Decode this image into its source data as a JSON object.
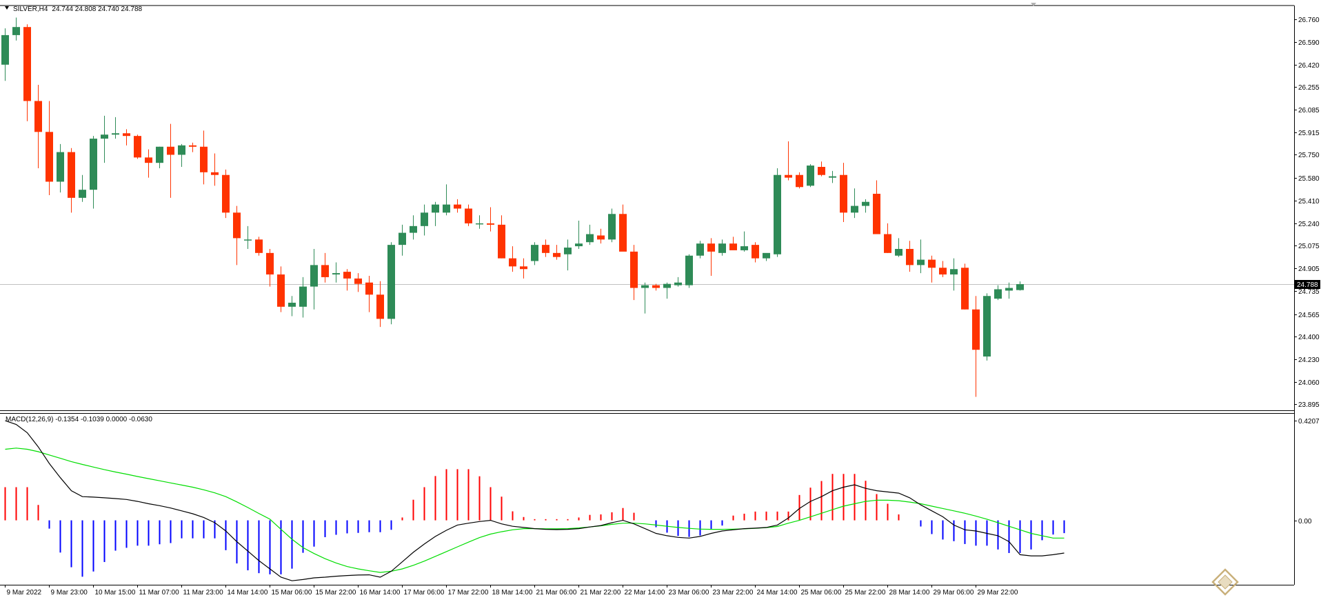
{
  "header": {
    "symbol": "SILVER,H4",
    "ohlc": "24.744 24.808 24.740 24.788"
  },
  "colors": {
    "bull": "#2e8b57",
    "bear": "#ff3300",
    "macd_pos": "#ff0000",
    "macd_neg": "#0000ff",
    "macd_line": "#000000",
    "signal_line": "#00dd00",
    "bid_line": "#c0c0c0",
    "axis": "#000000"
  },
  "chart_data": [
    {
      "type": "candlestick",
      "symbol": "SILVER,H4",
      "ylim": [
        23.85,
        26.86
      ],
      "y_ticks": [
        26.76,
        26.59,
        26.42,
        26.255,
        26.085,
        25.915,
        25.75,
        25.58,
        25.41,
        25.24,
        25.075,
        24.905,
        24.735,
        24.565,
        24.4,
        24.23,
        24.06,
        23.895
      ],
      "y_tick_labels": [
        "26.760",
        "26.590",
        "26.420",
        "26.255",
        "26.085",
        "25.915",
        "25.750",
        "25.580",
        "25.410",
        "25.240",
        "25.075",
        "24.905",
        "24.735",
        "24.565",
        "24.400",
        "24.230",
        "24.060",
        "23.895"
      ],
      "current_price": 24.788,
      "current_price_label": "24.788",
      "x_tick_labels": [
        {
          "i": 0,
          "label": "9 Mar 2022"
        },
        {
          "i": 4,
          "label": "9 Mar 23:00"
        },
        {
          "i": 8,
          "label": "10 Mar 15:00"
        },
        {
          "i": 12,
          "label": "11 Mar 07:00"
        },
        {
          "i": 16,
          "label": "11 Mar 23:00"
        },
        {
          "i": 20,
          "label": "14 Mar 14:00"
        },
        {
          "i": 24,
          "label": "15 Mar 06:00"
        },
        {
          "i": 28,
          "label": "15 Mar 22:00"
        },
        {
          "i": 32,
          "label": "16 Mar 14:00"
        },
        {
          "i": 36,
          "label": "17 Mar 06:00"
        },
        {
          "i": 40,
          "label": "17 Mar 22:00"
        },
        {
          "i": 44,
          "label": "18 Mar 14:00"
        },
        {
          "i": 48,
          "label": "21 Mar 06:00"
        },
        {
          "i": 52,
          "label": "21 Mar 22:00"
        },
        {
          "i": 56,
          "label": "22 Mar 14:00"
        },
        {
          "i": 60,
          "label": "23 Mar 06:00"
        },
        {
          "i": 64,
          "label": "23 Mar 22:00"
        },
        {
          "i": 68,
          "label": "24 Mar 14:00"
        },
        {
          "i": 72,
          "label": "25 Mar 06:00"
        },
        {
          "i": 76,
          "label": "25 Mar 22:00"
        },
        {
          "i": 80,
          "label": "28 Mar 14:00"
        },
        {
          "i": 84,
          "label": "29 Mar 06:00"
        },
        {
          "i": 88,
          "label": "29 Mar 22:00"
        }
      ],
      "candles": [
        [
          26.42,
          26.69,
          26.3,
          26.64
        ],
        [
          26.64,
          26.77,
          26.6,
          26.7
        ],
        [
          26.7,
          26.72,
          26.0,
          26.15
        ],
        [
          26.15,
          26.27,
          25.65,
          25.92
        ],
        [
          25.92,
          26.15,
          25.45,
          25.55
        ],
        [
          25.55,
          25.83,
          25.47,
          25.77
        ],
        [
          25.77,
          25.8,
          25.32,
          25.43
        ],
        [
          25.43,
          25.6,
          25.4,
          25.49
        ],
        [
          25.49,
          25.89,
          25.35,
          25.87
        ],
        [
          25.87,
          26.04,
          25.69,
          25.9
        ],
        [
          25.9,
          26.03,
          25.87,
          25.91
        ],
        [
          25.91,
          25.94,
          25.82,
          25.89
        ],
        [
          25.89,
          25.9,
          25.72,
          25.73
        ],
        [
          25.73,
          25.79,
          25.58,
          25.69
        ],
        [
          25.69,
          25.81,
          25.65,
          25.81
        ],
        [
          25.81,
          25.98,
          25.43,
          25.75
        ],
        [
          25.75,
          25.83,
          25.66,
          25.82
        ],
        [
          25.82,
          25.84,
          25.77,
          25.81
        ],
        [
          25.81,
          25.93,
          25.53,
          25.62
        ],
        [
          25.62,
          25.76,
          25.52,
          25.6
        ],
        [
          25.6,
          25.64,
          25.28,
          25.32
        ],
        [
          25.32,
          25.37,
          24.93,
          25.13
        ],
        [
          25.12,
          25.22,
          25.05,
          25.12
        ],
        [
          25.12,
          25.14,
          25.0,
          25.02
        ],
        [
          25.02,
          25.05,
          24.77,
          24.86
        ],
        [
          24.86,
          24.92,
          24.58,
          24.62
        ],
        [
          24.62,
          24.7,
          24.55,
          24.65
        ],
        [
          24.62,
          24.84,
          24.54,
          24.77
        ],
        [
          24.77,
          25.05,
          24.6,
          24.93
        ],
        [
          24.93,
          25.02,
          24.8,
          24.84
        ],
        [
          24.86,
          24.95,
          24.8,
          24.87
        ],
        [
          24.88,
          24.9,
          24.74,
          24.83
        ],
        [
          24.83,
          24.87,
          24.73,
          24.79
        ],
        [
          24.8,
          24.85,
          24.58,
          24.71
        ],
        [
          24.71,
          24.81,
          24.47,
          24.53
        ],
        [
          24.53,
          25.1,
          24.49,
          25.08
        ],
        [
          25.08,
          25.23,
          25.0,
          25.17
        ],
        [
          25.17,
          25.3,
          25.12,
          25.22
        ],
        [
          25.22,
          25.38,
          25.15,
          25.32
        ],
        [
          25.32,
          25.4,
          25.22,
          25.38
        ],
        [
          25.32,
          25.53,
          25.3,
          25.38
        ],
        [
          25.38,
          25.42,
          25.32,
          25.35
        ],
        [
          25.35,
          25.38,
          25.22,
          25.24
        ],
        [
          25.24,
          25.3,
          25.2,
          25.24
        ],
        [
          25.24,
          25.36,
          25.18,
          25.23
        ],
        [
          25.23,
          25.3,
          24.98,
          24.98
        ],
        [
          24.98,
          25.07,
          24.88,
          24.92
        ],
        [
          24.92,
          24.98,
          24.83,
          24.9
        ],
        [
          24.96,
          25.1,
          24.93,
          25.08
        ],
        [
          25.08,
          25.12,
          24.99,
          25.02
        ],
        [
          25.02,
          25.08,
          24.97,
          24.99
        ],
        [
          25.01,
          25.12,
          24.89,
          25.06
        ],
        [
          25.07,
          25.26,
          25.05,
          25.09
        ],
        [
          25.1,
          25.23,
          25.08,
          25.16
        ],
        [
          25.15,
          25.2,
          25.09,
          25.12
        ],
        [
          25.12,
          25.35,
          25.1,
          25.31
        ],
        [
          25.31,
          25.38,
          25.04,
          25.03
        ],
        [
          25.03,
          25.08,
          24.67,
          24.76
        ],
        [
          24.76,
          24.8,
          24.57,
          24.78
        ],
        [
          24.78,
          24.79,
          24.74,
          24.76
        ],
        [
          24.76,
          24.8,
          24.68,
          24.79
        ],
        [
          24.78,
          24.84,
          24.77,
          24.8
        ],
        [
          24.78,
          25.01,
          24.76,
          25.0
        ],
        [
          25.0,
          25.11,
          24.98,
          25.09
        ],
        [
          25.09,
          25.13,
          24.85,
          25.03
        ],
        [
          25.02,
          25.12,
          25.0,
          25.09
        ],
        [
          25.09,
          25.14,
          25.07,
          25.04
        ],
        [
          25.04,
          25.18,
          25.03,
          25.07
        ],
        [
          25.08,
          25.1,
          24.95,
          24.98
        ],
        [
          24.98,
          25.01,
          24.96,
          25.02
        ],
        [
          25.01,
          25.65,
          24.99,
          25.6
        ],
        [
          25.6,
          25.85,
          25.56,
          25.58
        ],
        [
          25.6,
          25.62,
          25.5,
          25.51
        ],
        [
          25.52,
          25.68,
          25.51,
          25.67
        ],
        [
          25.66,
          25.7,
          25.59,
          25.6
        ],
        [
          25.58,
          25.63,
          25.54,
          25.59
        ],
        [
          25.6,
          25.69,
          25.25,
          25.32
        ],
        [
          25.32,
          25.5,
          25.28,
          25.37
        ],
        [
          25.37,
          25.42,
          25.32,
          25.4
        ],
        [
          25.46,
          25.56,
          25.16,
          25.16
        ],
        [
          25.16,
          25.24,
          25.02,
          25.02
        ],
        [
          25.0,
          25.13,
          24.99,
          25.05
        ],
        [
          25.05,
          25.11,
          24.88,
          24.93
        ],
        [
          24.93,
          25.12,
          24.87,
          24.97
        ],
        [
          24.97,
          25.0,
          24.8,
          24.91
        ],
        [
          24.91,
          24.96,
          24.84,
          24.86
        ],
        [
          24.86,
          24.98,
          24.74,
          24.9
        ],
        [
          24.91,
          24.94,
          24.6,
          24.6
        ],
        [
          24.6,
          24.7,
          23.95,
          24.3
        ],
        [
          24.25,
          24.72,
          24.22,
          24.7
        ],
        [
          24.68,
          24.78,
          24.67,
          24.75
        ],
        [
          24.74,
          24.8,
          24.68,
          24.76
        ],
        [
          24.744,
          24.808,
          24.74,
          24.788
        ]
      ]
    },
    {
      "type": "bar+line",
      "title": "MACD(12,26,9) -0.1354 -0.1039 0.0000 -0.0630",
      "ylim": [
        -0.272,
        0.45
      ],
      "y_ticks": [
        0.4207,
        0.0
      ],
      "y_tick_labels": [
        "0.4207",
        "0.00"
      ],
      "histogram": [
        0.14,
        0.14,
        0.14,
        0.065,
        -0.035,
        -0.136,
        -0.198,
        -0.238,
        -0.216,
        -0.176,
        -0.128,
        -0.116,
        -0.107,
        -0.107,
        -0.101,
        -0.096,
        -0.076,
        -0.076,
        -0.076,
        -0.076,
        -0.126,
        -0.182,
        -0.211,
        -0.223,
        -0.228,
        -0.228,
        -0.204,
        -0.137,
        -0.111,
        -0.071,
        -0.061,
        -0.055,
        -0.053,
        -0.05,
        -0.05,
        -0.04,
        0.012,
        0.087,
        0.14,
        0.187,
        0.216,
        0.216,
        0.216,
        0.186,
        0.14,
        0.1,
        0.038,
        0.014,
        0.005,
        0.005,
        0.005,
        0.005,
        0.012,
        0.023,
        0.025,
        0.034,
        0.052,
        0.032,
        0.0,
        -0.029,
        -0.052,
        -0.066,
        -0.07,
        -0.064,
        -0.036,
        -0.022,
        0.02,
        0.028,
        0.037,
        0.037,
        0.037,
        0.037,
        0.107,
        0.138,
        0.166,
        0.196,
        0.196,
        0.196,
        0.167,
        0.111,
        0.07,
        0.025,
        0.0,
        -0.026,
        -0.058,
        -0.081,
        -0.088,
        -0.1,
        -0.107,
        -0.107,
        -0.123,
        -0.138,
        -0.138,
        -0.123,
        -0.084,
        -0.06,
        -0.054
      ],
      "macd": [
        0.4207,
        0.405,
        0.37,
        0.31,
        0.24,
        0.18,
        0.125,
        0.1,
        0.098,
        0.095,
        0.092,
        0.088,
        0.08,
        0.07,
        0.062,
        0.052,
        0.04,
        0.028,
        0.012,
        -0.01,
        -0.045,
        -0.09,
        -0.13,
        -0.17,
        -0.205,
        -0.24,
        -0.255,
        -0.25,
        -0.243,
        -0.24,
        -0.236,
        -0.233,
        -0.231,
        -0.23,
        -0.24,
        -0.215,
        -0.175,
        -0.135,
        -0.1,
        -0.068,
        -0.042,
        -0.02,
        -0.012,
        -0.005,
        0.0,
        -0.015,
        -0.025,
        -0.03,
        -0.035,
        -0.038,
        -0.039,
        -0.038,
        -0.035,
        -0.028,
        -0.022,
        -0.01,
        0.0,
        -0.015,
        -0.035,
        -0.055,
        -0.065,
        -0.072,
        -0.075,
        -0.068,
        -0.055,
        -0.045,
        -0.04,
        -0.035,
        -0.033,
        -0.03,
        -0.02,
        0.01,
        0.05,
        0.08,
        0.1,
        0.125,
        0.14,
        0.15,
        0.135,
        0.125,
        0.12,
        0.115,
        0.095,
        0.065,
        0.04,
        0.015,
        -0.02,
        -0.04,
        -0.045,
        -0.055,
        -0.065,
        -0.09,
        -0.145,
        -0.15,
        -0.15,
        -0.145,
        -0.138
      ],
      "signal": [
        0.3,
        0.305,
        0.3,
        0.29,
        0.276,
        0.262,
        0.248,
        0.236,
        0.225,
        0.214,
        0.204,
        0.195,
        0.185,
        0.176,
        0.167,
        0.158,
        0.149,
        0.14,
        0.129,
        0.116,
        0.1,
        0.078,
        0.054,
        0.029,
        0.005,
        -0.038,
        -0.08,
        -0.115,
        -0.14,
        -0.162,
        -0.18,
        -0.195,
        -0.205,
        -0.213,
        -0.22,
        -0.215,
        -0.205,
        -0.19,
        -0.172,
        -0.152,
        -0.132,
        -0.112,
        -0.092,
        -0.073,
        -0.058,
        -0.048,
        -0.04,
        -0.035,
        -0.035,
        -0.036,
        -0.036,
        -0.035,
        -0.032,
        -0.028,
        -0.023,
        -0.017,
        -0.012,
        -0.012,
        -0.015,
        -0.02,
        -0.025,
        -0.03,
        -0.034,
        -0.037,
        -0.038,
        -0.038,
        -0.037,
        -0.036,
        -0.034,
        -0.031,
        -0.026,
        -0.012,
        0.0,
        0.015,
        0.03,
        0.045,
        0.06,
        0.07,
        0.08,
        0.085,
        0.085,
        0.083,
        0.077,
        0.07,
        0.06,
        0.05,
        0.04,
        0.03,
        0.018,
        0.005,
        -0.01,
        -0.025,
        -0.04,
        -0.055,
        -0.065,
        -0.075,
        -0.075
      ]
    }
  ]
}
